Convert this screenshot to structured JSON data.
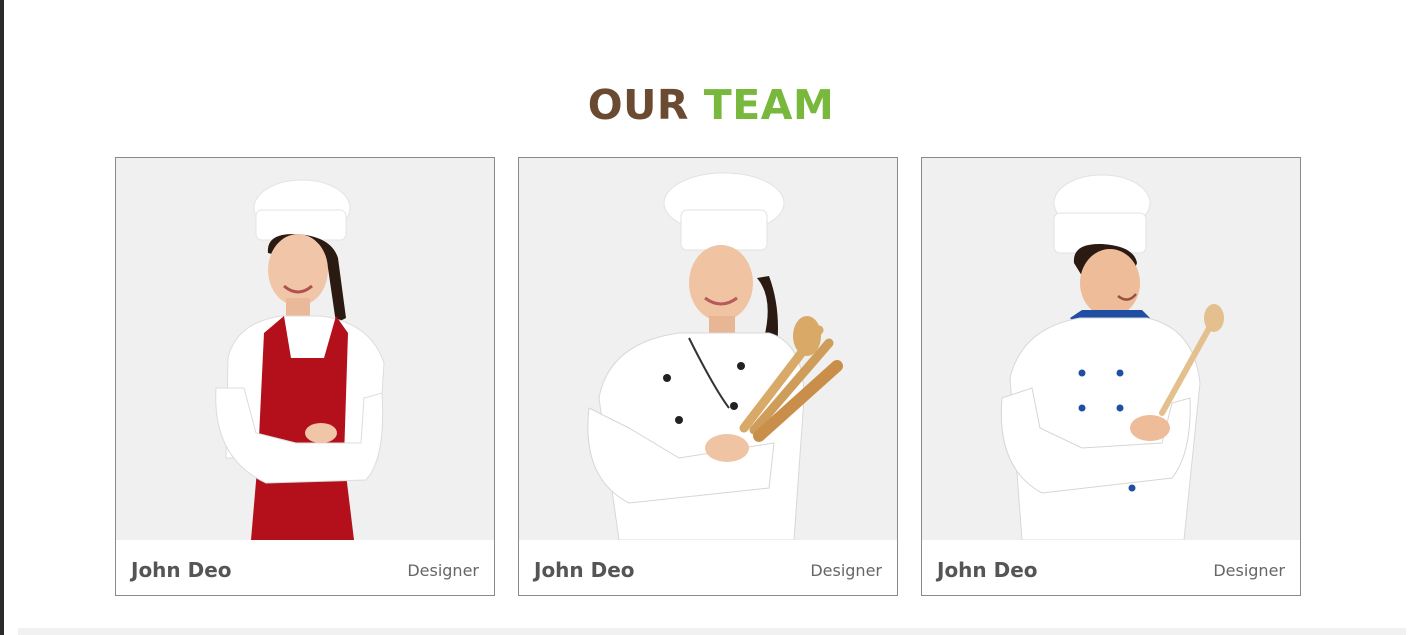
{
  "section": {
    "title_part1": "OUR",
    "title_part2": "TEAM",
    "title_color_1": "#6a4a30",
    "title_color_2": "#78b83c"
  },
  "team": [
    {
      "name": "John Deo",
      "role": "Designer",
      "photo": "chef-woman-red-apron"
    },
    {
      "name": "John Deo",
      "role": "Designer",
      "photo": "chef-woman-wooden-spoons"
    },
    {
      "name": "John Deo",
      "role": "Designer",
      "photo": "chef-man-wooden-spoon"
    }
  ]
}
